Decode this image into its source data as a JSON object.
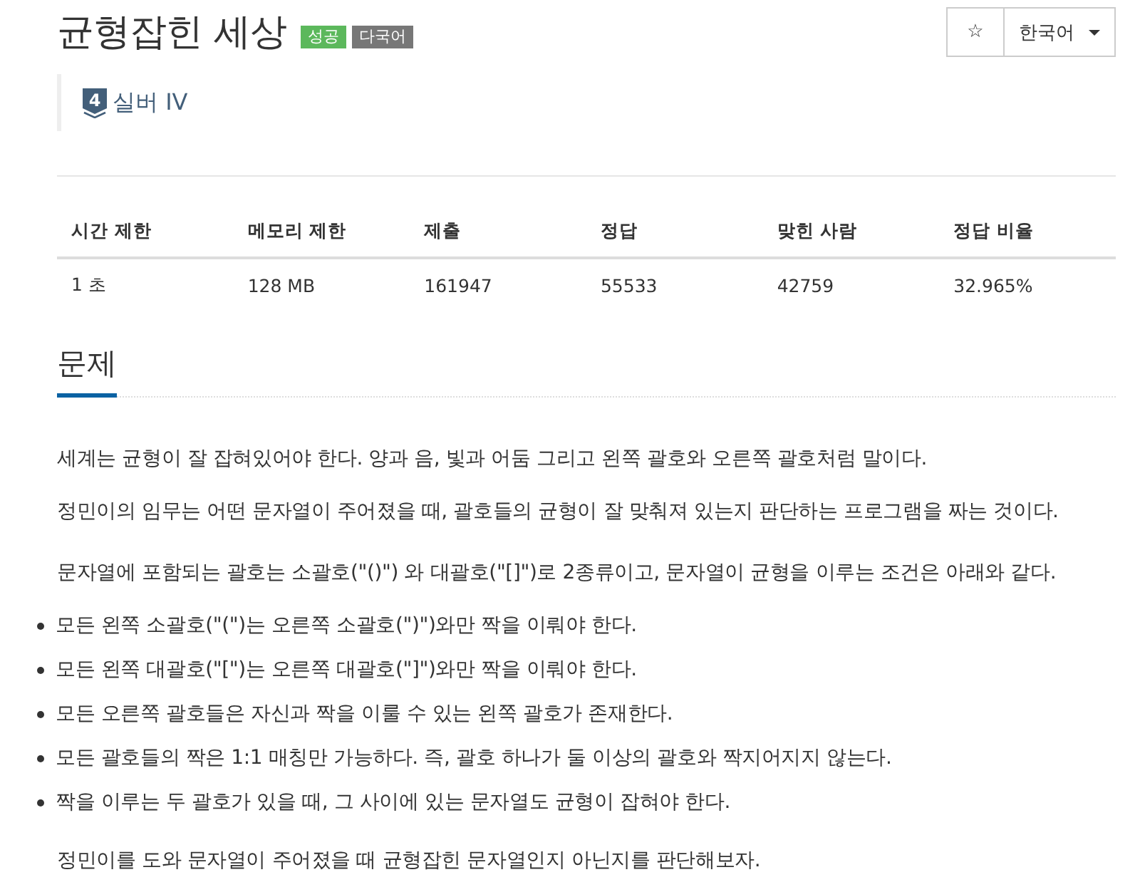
{
  "header": {
    "title": "균형잡힌 세상",
    "badges": [
      {
        "label": "성공",
        "color": "#5cb85c"
      },
      {
        "label": "다국어",
        "color": "#777777"
      }
    ],
    "star": "☆",
    "language": "한국어",
    "tier": {
      "number": "4",
      "label": "실버 IV"
    }
  },
  "stats": {
    "columns": [
      "시간 제한",
      "메모리 제한",
      "제출",
      "정답",
      "맞힌 사람",
      "정답 비율"
    ],
    "rows": [
      [
        "1 초",
        "128 MB",
        "161947",
        "55533",
        "42759",
        "32.965%"
      ]
    ]
  },
  "problem": {
    "heading": "문제",
    "paragraphs": [
      "세계는 균형이 잘 잡혀있어야 한다. 양과 음, 빛과 어둠 그리고 왼쪽 괄호와 오른쪽 괄호처럼 말이다.",
      "정민이의 임무는 어떤 문자열이 주어졌을 때, 괄호들의 균형이 잘 맞춰져 있는지 판단하는 프로그램을 짜는 것이다.",
      "문자열에 포함되는 괄호는 소괄호(\"()\") 와 대괄호(\"[]\")로 2종류이고, 문자열이 균형을 이루는 조건은 아래와 같다."
    ],
    "conditions": [
      "모든 왼쪽 소괄호(\"(\")는 오른쪽 소괄호(\")\")와만 짝을 이뤄야 한다.",
      "모든 왼쪽 대괄호(\"[\")는 오른쪽 대괄호(\"]\")와만 짝을 이뤄야 한다.",
      "모든 오른쪽 괄호들은 자신과 짝을 이룰 수 있는 왼쪽 괄호가 존재한다.",
      "모든 괄호들의 짝은 1:1 매칭만 가능하다. 즉, 괄호 하나가 둘 이상의 괄호와 짝지어지지 않는다.",
      "짝을 이루는 두 괄호가 있을 때, 그 사이에 있는 문자열도 균형이 잡혀야 한다."
    ],
    "closing": "정민이를 도와 문자열이 주어졌을 때 균형잡힌 문자열인지 아닌지를 판단해보자."
  }
}
